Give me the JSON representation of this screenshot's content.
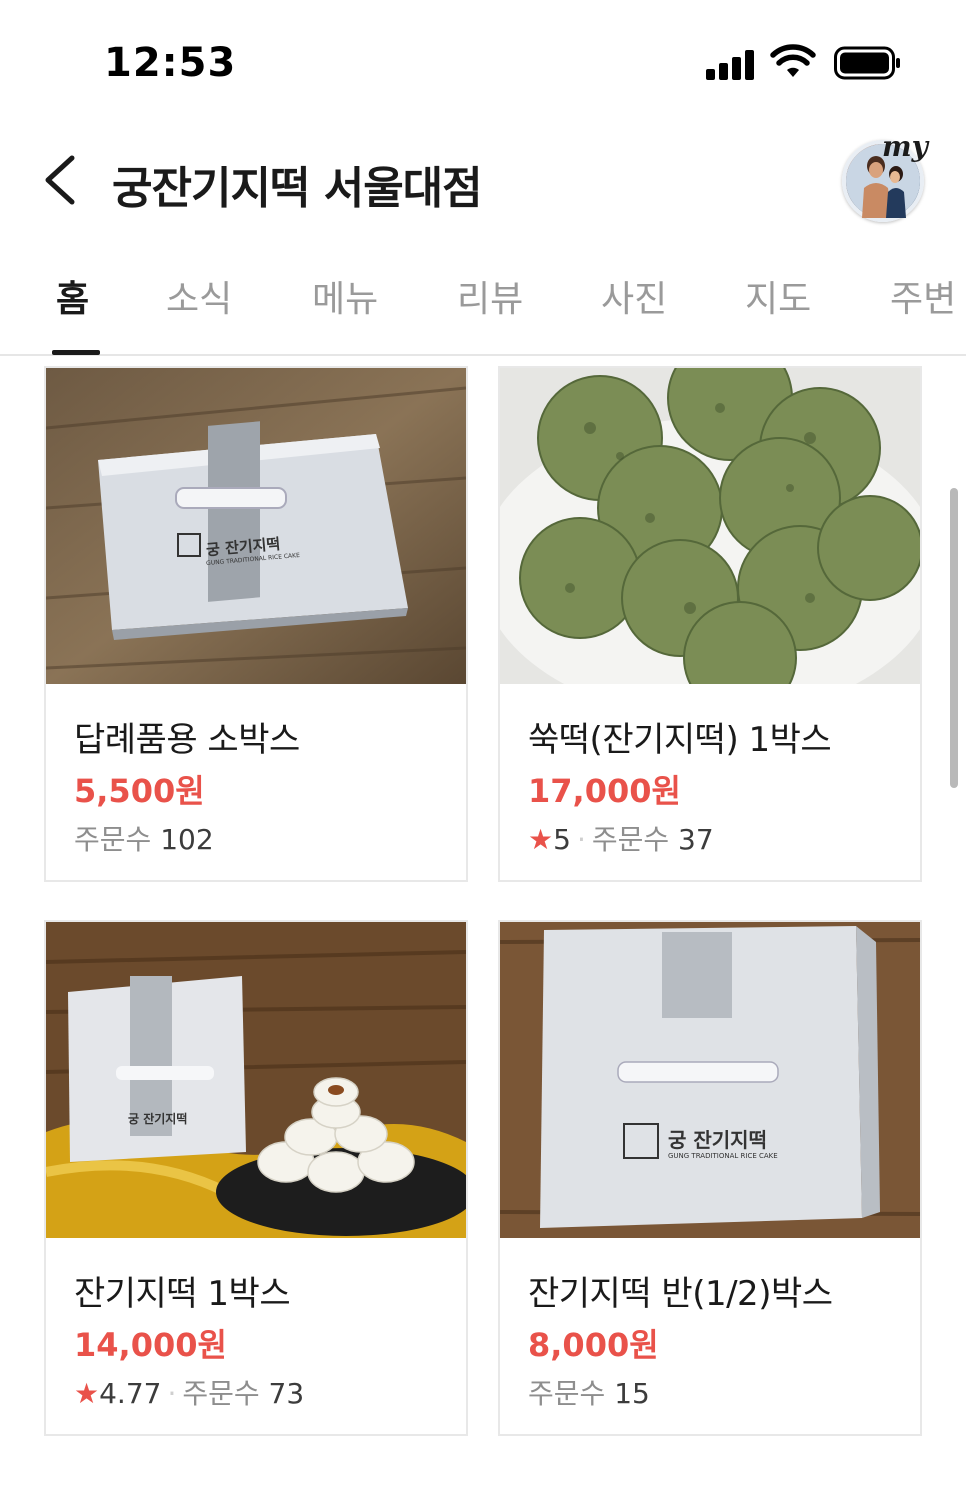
{
  "status_bar": {
    "time": "12:53"
  },
  "header": {
    "title": "궁잔기지떡 서울대점",
    "avatar_badge": "my"
  },
  "tabs": [
    {
      "label": "홈",
      "active": true
    },
    {
      "label": "소식",
      "active": false
    },
    {
      "label": "메뉴",
      "active": false
    },
    {
      "label": "리뷰",
      "active": false
    },
    {
      "label": "사진",
      "active": false
    },
    {
      "label": "지도",
      "active": false
    },
    {
      "label": "주변",
      "active": false
    }
  ],
  "products": [
    {
      "name": "답례품용 소박스",
      "price": "5,500원",
      "rating": "",
      "order_label": "주문수",
      "orders": "102"
    },
    {
      "name": "쑥떡(잔기지떡) 1박스",
      "price": "17,000원",
      "rating": "5",
      "order_label": "주문수",
      "orders": "37"
    },
    {
      "name": "잔기지떡 1박스",
      "price": "14,000원",
      "rating": "4.77",
      "order_label": "주문수",
      "orders": "73"
    },
    {
      "name": "잔기지떡 반(1/2)박스",
      "price": "8,000원",
      "rating": "",
      "order_label": "주문수",
      "orders": "15"
    }
  ],
  "box_brand": {
    "name": "궁 잔기지떡",
    "subtitle": "GUNG TRADITIONAL RICE CAKE"
  },
  "colors": {
    "price": "#e9524a",
    "star": "#e9524a",
    "text": "#1a1a1a",
    "muted": "#8e8e8e"
  },
  "icons": {
    "back": "chevron-left-icon",
    "star": "star-icon",
    "signal": "signal-icon",
    "wifi": "wifi-icon",
    "battery": "battery-icon"
  }
}
